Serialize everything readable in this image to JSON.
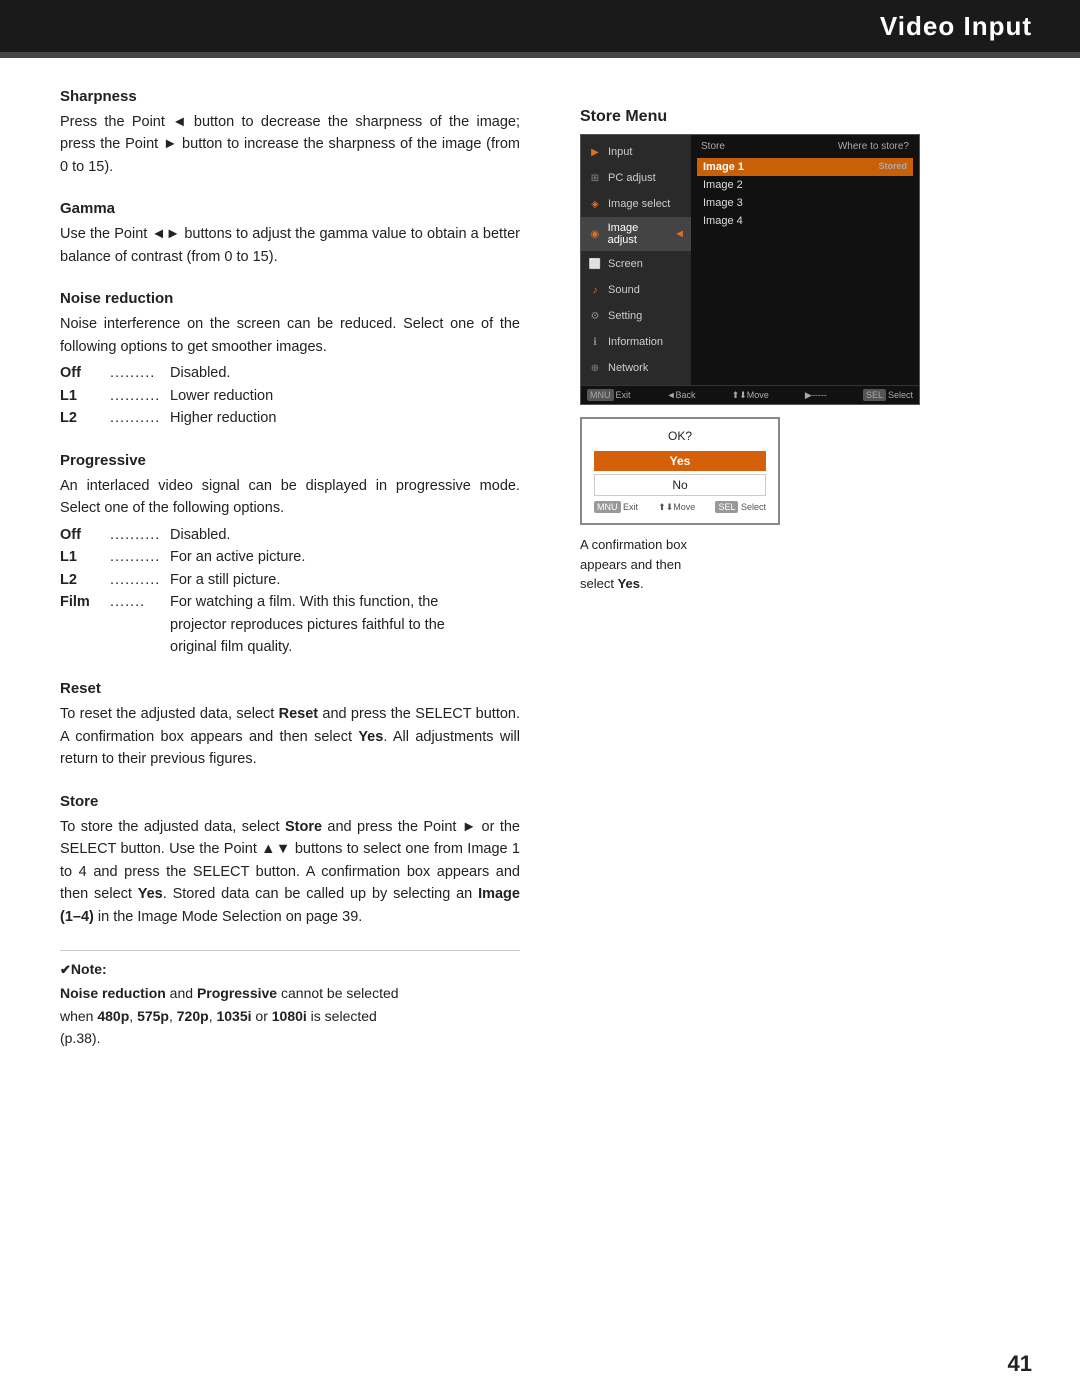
{
  "header": {
    "title": "Video Input",
    "bg": "#1a1a1a",
    "text_color": "#ffffff"
  },
  "page_number": "41",
  "sections": {
    "sharpness": {
      "title": "Sharpness",
      "body": "Press the Point ◄ button to decrease the sharpness of the image; press the Point ► button to increase the sharpness of the image (from 0 to 15)."
    },
    "gamma": {
      "title": "Gamma",
      "body": "Use the Point ◄► buttons to adjust the gamma value to obtain a better balance of contrast (from 0 to 15)."
    },
    "noise_reduction": {
      "title": "Noise reduction",
      "body": "Noise interference on the screen can be reduced. Select one of the following options to get smoother images.",
      "options": [
        {
          "key": "Off",
          "dots": ".........",
          "val": "Disabled."
        },
        {
          "key": "L1",
          "dots": "..........",
          "val": "Lower reduction"
        },
        {
          "key": "L2",
          "dots": "..........",
          "val": "Higher reduction"
        }
      ]
    },
    "progressive": {
      "title": "Progressive",
      "body": "An interlaced video signal can be displayed in progressive mode. Select one of the following options.",
      "options": [
        {
          "key": "Off",
          "dots": "..........",
          "val": "Disabled."
        },
        {
          "key": "L1",
          "dots": "..........",
          "val": "For an active picture."
        },
        {
          "key": "L2",
          "dots": "..........",
          "val": "For a still picture."
        },
        {
          "key": "Film",
          "dots": ".......",
          "val": "For watching a film. With this function, the"
        },
        {
          "key": "",
          "dots": "",
          "val": "projector reproduces pictures faithful to the"
        },
        {
          "key": "",
          "dots": "",
          "val": "original film quality."
        }
      ]
    },
    "reset": {
      "title": "Reset",
      "body": "To reset the adjusted data, select Reset and press the SELECT button. A confirmation box appears and then select Yes. All adjustments will return to their previous figures."
    },
    "store": {
      "title": "Store",
      "body": "To store the adjusted data, select Store and press the Point ► or the SELECT button. Use the Point ▲▼ buttons to select one from Image 1 to 4 and press the SELECT button. A confirmation box appears and then select Yes. Stored data can be called up by selecting an Image (1–4) in the Image Mode Selection on page 39."
    }
  },
  "store_menu": {
    "label": "Store Menu",
    "sidebar_items": [
      {
        "icon": "▶",
        "label": "Input"
      },
      {
        "icon": "⊞",
        "label": "PC adjust"
      },
      {
        "icon": "◈",
        "label": "Image select",
        "active": false
      },
      {
        "icon": "◉",
        "label": "Image adjust",
        "active": true
      },
      {
        "icon": "⬜",
        "label": "Screen"
      },
      {
        "icon": "♪",
        "label": "Sound"
      },
      {
        "icon": "⚙",
        "label": "Setting"
      },
      {
        "icon": "ℹ",
        "label": "Information"
      },
      {
        "icon": "⊕",
        "label": "Network"
      }
    ],
    "main_header": {
      "left": "Store",
      "right": "Where to store?"
    },
    "options": [
      {
        "label": "Image 1",
        "highlighted": true,
        "right": "Stored"
      },
      {
        "label": "Image 2",
        "highlighted": false
      },
      {
        "label": "Image 3",
        "highlighted": false
      },
      {
        "label": "Image 4",
        "highlighted": false
      }
    ],
    "footer": {
      "exit": "Exit",
      "back": "◄Back",
      "move": "⬆⬇Move",
      "select": "Select"
    }
  },
  "confirm_box": {
    "title": "OK?",
    "yes": "Yes",
    "no": "No",
    "footer": {
      "exit": "Exit",
      "move": "⬆⬇Move",
      "select": "Select"
    },
    "caption": "A confirmation box\nappears and then\nselect Yes."
  },
  "note": {
    "symbol": "✔",
    "label": "Note:",
    "bold_part": "Noise reduction",
    "and_text": " and ",
    "bold_part2": "Progressive",
    "body1": " cannot be selected\nwhen ",
    "bold_480": "480p",
    "comma1": ", ",
    "bold_575": "575p",
    "comma2": ", ",
    "bold_720": "720p",
    "comma3": ", ",
    "bold_1035": "1035i",
    "or_text": " or ",
    "bold_1080": "1080i",
    "body2": " is selected\n(p.38)."
  }
}
